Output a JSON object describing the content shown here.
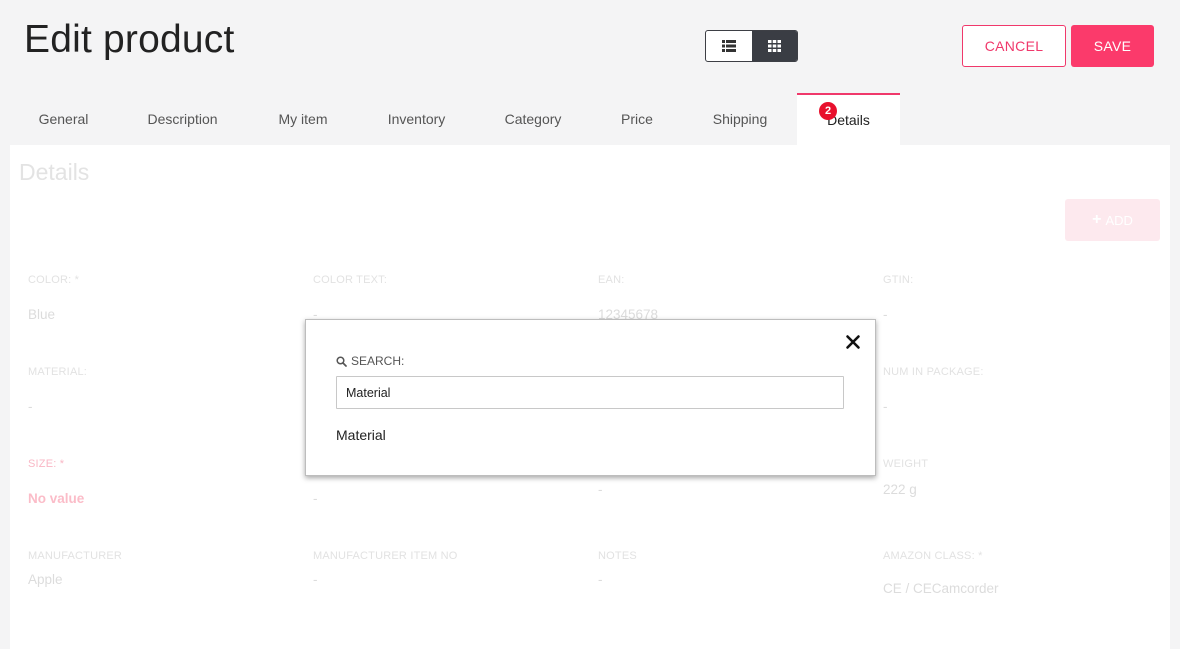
{
  "header": {
    "title": "Edit product",
    "cancel_label": "CANCEL",
    "save_label": "SAVE"
  },
  "view_toggle": {
    "options": [
      "list-view",
      "grid-view"
    ],
    "active": "grid-view"
  },
  "tabs": [
    {
      "label": "General"
    },
    {
      "label": "Description"
    },
    {
      "label": "My item"
    },
    {
      "label": "Inventory"
    },
    {
      "label": "Category"
    },
    {
      "label": "Price"
    },
    {
      "label": "Shipping"
    },
    {
      "label": "Details",
      "badge": "2",
      "active": true
    }
  ],
  "panel": {
    "title": "Details",
    "add_label": "ADD"
  },
  "fields": {
    "color": {
      "label": "COLOR: *",
      "value": "Blue"
    },
    "color_text": {
      "label": "COLOR TEXT:",
      "value": "-"
    },
    "ean": {
      "label": "EAN:",
      "value": "12345678"
    },
    "gtin": {
      "label": "GTIN:",
      "value": "-"
    },
    "material": {
      "label": "MATERIAL:",
      "value": "-"
    },
    "num_in_package": {
      "label": "NUM IN PACKAGE:",
      "value": "-"
    },
    "size": {
      "label": "SIZE: *",
      "value": "No value"
    },
    "size_col2_value": "-",
    "size_col3_value": "-",
    "weight": {
      "label": "WEIGHT",
      "value": "222 g"
    },
    "manufacturer": {
      "label": "MANUFACTURER",
      "value": "Apple"
    },
    "manufacturer_item_no": {
      "label": "MANUFACTURER ITEM NO",
      "value": "-"
    },
    "notes": {
      "label": "NOTES",
      "value": "-"
    },
    "amazon_class": {
      "label": "AMAZON CLASS: *",
      "value": "CE / CECamcorder"
    }
  },
  "search_modal": {
    "label": "SEARCH:",
    "input_value": "Material",
    "results": [
      "Material"
    ]
  },
  "colors": {
    "accent": "#fb3a6b",
    "badge": "#e8102d",
    "dark_toggle": "#3a3d44"
  }
}
